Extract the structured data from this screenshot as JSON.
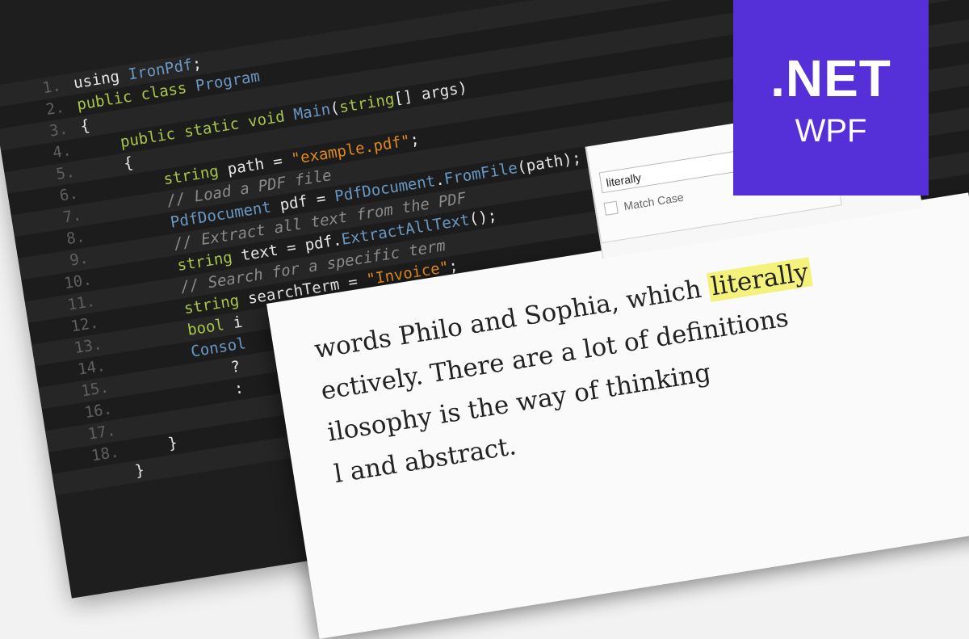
{
  "code_editor": {
    "lines": [
      {
        "num": "1.",
        "tokens": [
          {
            "t": "using ",
            "c": "pl"
          },
          {
            "t": "IronPdf",
            "c": "ty"
          },
          {
            "t": ";",
            "c": "pl"
          }
        ]
      },
      {
        "num": "2.",
        "tokens": [
          {
            "t": "public class ",
            "c": "kw"
          },
          {
            "t": "Program",
            "c": "ty"
          }
        ]
      },
      {
        "num": "3.",
        "tokens": [
          {
            "t": "{",
            "c": "pl"
          }
        ]
      },
      {
        "num": "4.",
        "tokens": [
          {
            "t": "    public static void ",
            "c": "kw"
          },
          {
            "t": "Main",
            "c": "ty"
          },
          {
            "t": "(",
            "c": "pl"
          },
          {
            "t": "string",
            "c": "kw"
          },
          {
            "t": "[] args)",
            "c": "pl"
          }
        ]
      },
      {
        "num": "5.",
        "tokens": [
          {
            "t": "    {",
            "c": "pl"
          }
        ]
      },
      {
        "num": "6.",
        "tokens": [
          {
            "t": "        string ",
            "c": "kw"
          },
          {
            "t": "path = ",
            "c": "pl"
          },
          {
            "t": "\"example.pdf\"",
            "c": "str"
          },
          {
            "t": ";",
            "c": "pl"
          }
        ]
      },
      {
        "num": "7.",
        "tokens": [
          {
            "t": "        // Load a PDF file",
            "c": "cm"
          }
        ]
      },
      {
        "num": "8.",
        "tokens": [
          {
            "t": "        PdfDocument ",
            "c": "ty"
          },
          {
            "t": "pdf = ",
            "c": "pl"
          },
          {
            "t": "PdfDocument",
            "c": "ty"
          },
          {
            "t": ".",
            "c": "pl"
          },
          {
            "t": "FromFile",
            "c": "ty"
          },
          {
            "t": "(path);",
            "c": "pl"
          }
        ]
      },
      {
        "num": "9.",
        "tokens": [
          {
            "t": "        // Extract all text from the PDF",
            "c": "cm"
          }
        ]
      },
      {
        "num": "10.",
        "tokens": [
          {
            "t": "        string ",
            "c": "kw"
          },
          {
            "t": "text = pdf.",
            "c": "pl"
          },
          {
            "t": "ExtractAllText",
            "c": "ty"
          },
          {
            "t": "();",
            "c": "pl"
          }
        ]
      },
      {
        "num": "11.",
        "tokens": [
          {
            "t": "        // Search for a specific term",
            "c": "cm"
          }
        ]
      },
      {
        "num": "12.",
        "tokens": [
          {
            "t": "        string ",
            "c": "kw"
          },
          {
            "t": "searchTerm = ",
            "c": "pl"
          },
          {
            "t": "\"Invoice\"",
            "c": "str"
          },
          {
            "t": ";",
            "c": "pl"
          }
        ]
      },
      {
        "num": "13.",
        "tokens": [
          {
            "t": "        bool ",
            "c": "kw"
          },
          {
            "t": "i",
            "c": "pl"
          }
        ]
      },
      {
        "num": "14.",
        "tokens": [
          {
            "t": "        Consol",
            "c": "ty"
          }
        ]
      },
      {
        "num": "15.",
        "tokens": [
          {
            "t": "            ?",
            "c": "pl"
          }
        ]
      },
      {
        "num": "16.",
        "tokens": [
          {
            "t": "            :",
            "c": "pl"
          }
        ]
      },
      {
        "num": "17.",
        "tokens": [
          {
            "t": "",
            "c": "pl"
          }
        ]
      },
      {
        "num": "18.",
        "tokens": [
          {
            "t": "    }",
            "c": "pl"
          }
        ]
      },
      {
        "num": "",
        "tokens": [
          {
            "t": "}",
            "c": "pl"
          }
        ]
      }
    ]
  },
  "viewer": {
    "search_value": "literally",
    "match_case_label": "Match Case",
    "doc_lines": [
      {
        "before": "words Philo and Sophia, which ",
        "highlight": "literally",
        "after": ""
      },
      {
        "before": "ectively. There are a lot of definitions",
        "highlight": "",
        "after": ""
      },
      {
        "before": "ilosophy is the way of thinking",
        "highlight": "",
        "after": ""
      },
      {
        "before": "                         l and abstract.",
        "highlight": "",
        "after": ""
      }
    ]
  },
  "badge": {
    "title": ".NET",
    "subtitle": "WPF",
    "color": "#5530d9"
  }
}
